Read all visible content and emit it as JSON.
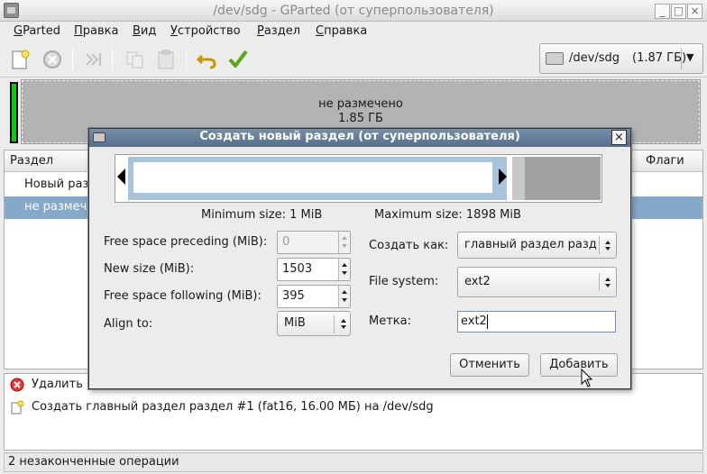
{
  "window": {
    "title": "/dev/sdg - GParted (от суперпользователя)",
    "controls": [
      "_",
      "□",
      "×"
    ]
  },
  "menu": [
    "GParted",
    "Правка",
    "Вид",
    "Устройство",
    "Раздел",
    "Справка"
  ],
  "toolbar": {
    "icons": [
      "new-partition-icon",
      "delete-icon",
      "resize-move-icon",
      "copy-icon",
      "paste-icon",
      "undo-icon",
      "apply-icon"
    ],
    "device": "/dev/sdg",
    "device_size": "(1.87 ГБ)"
  },
  "graph": {
    "label": "не размечено",
    "size": "1.85 ГБ"
  },
  "partition_list": {
    "columns": [
      "Раздел",
      "Флаги"
    ],
    "rows": [
      "Новый разд",
      "не размечено"
    ]
  },
  "operations": [
    {
      "icon": "delete-icon",
      "text": "Удалить"
    },
    {
      "icon": "new-partition-icon",
      "text": "Создать главный раздел раздел #1 (fat16, 16.00 МБ) на /dev/sdg"
    }
  ],
  "status": "2 незаконченные операции",
  "dialog": {
    "title": "Создать новый раздел (от суперпользователя)",
    "min_size": "Minimum size: 1 MiB",
    "max_size": "Maximum size: 1898 MiB",
    "fields": {
      "free_preceding": {
        "label": "Free space preceding (MiB):",
        "value": "0"
      },
      "new_size": {
        "label": "New size (MiB):",
        "value": "1503"
      },
      "free_following": {
        "label": "Free space following (MiB):",
        "value": "395"
      },
      "align_to": {
        "label": "Align to:",
        "value": "MiB"
      },
      "create_as": {
        "label": "Создать как:",
        "value": "главный раздел разд"
      },
      "file_system": {
        "label": "File system:",
        "value": "ext2"
      },
      "label": {
        "label": "Метка:",
        "value": "ext2"
      }
    },
    "buttons": {
      "cancel": "Отменить",
      "add": "Добавить"
    }
  },
  "colors": {
    "selection": "#86a8c9",
    "dialog_title": "#5f7893",
    "unallocated": "#b3b3b3",
    "partition_border": "#00d400"
  }
}
